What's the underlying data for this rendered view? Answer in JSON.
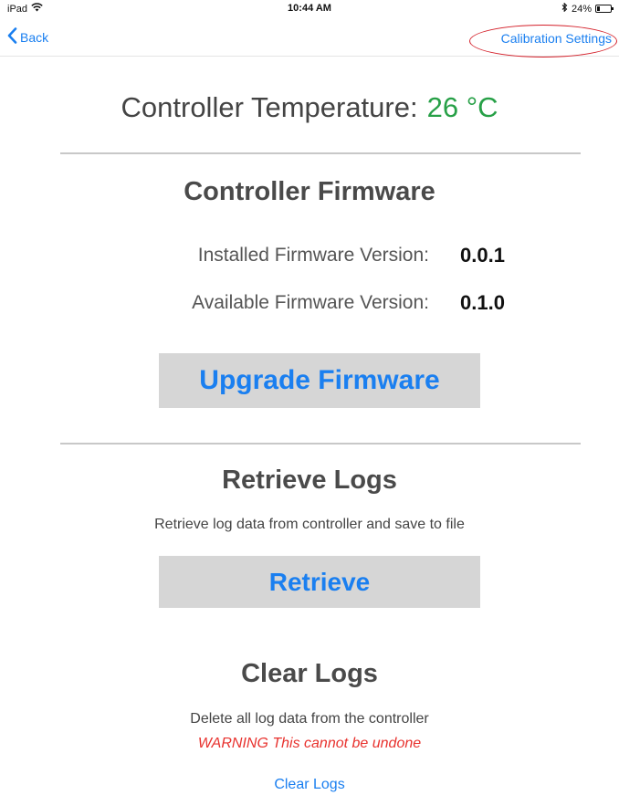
{
  "status_bar": {
    "device": "iPad",
    "time": "10:44 AM",
    "battery_text": "24%",
    "battery_level": 0.24
  },
  "nav": {
    "back_label": "Back",
    "calibration_label": "Calibration Settings"
  },
  "temperature": {
    "label": "Controller Temperature:",
    "value": "26 °C",
    "value_color": "#27a047"
  },
  "firmware": {
    "title": "Controller Firmware",
    "installed_label": "Installed Firmware Version:",
    "installed_value": "0.0.1",
    "available_label": "Available Firmware Version:",
    "available_value": "0.1.0",
    "upgrade_button": "Upgrade Firmware"
  },
  "retrieve_logs": {
    "title": "Retrieve Logs",
    "description": "Retrieve log data from controller and save to file",
    "button": "Retrieve"
  },
  "clear_logs": {
    "title": "Clear Logs",
    "description": "Delete all log data from the controller",
    "warning": "WARNING This cannot be undone",
    "link": "Clear Logs",
    "warning_color": "#e8322e"
  },
  "colors": {
    "accent": "#1a7ff0",
    "annotation": "#d4202a"
  }
}
